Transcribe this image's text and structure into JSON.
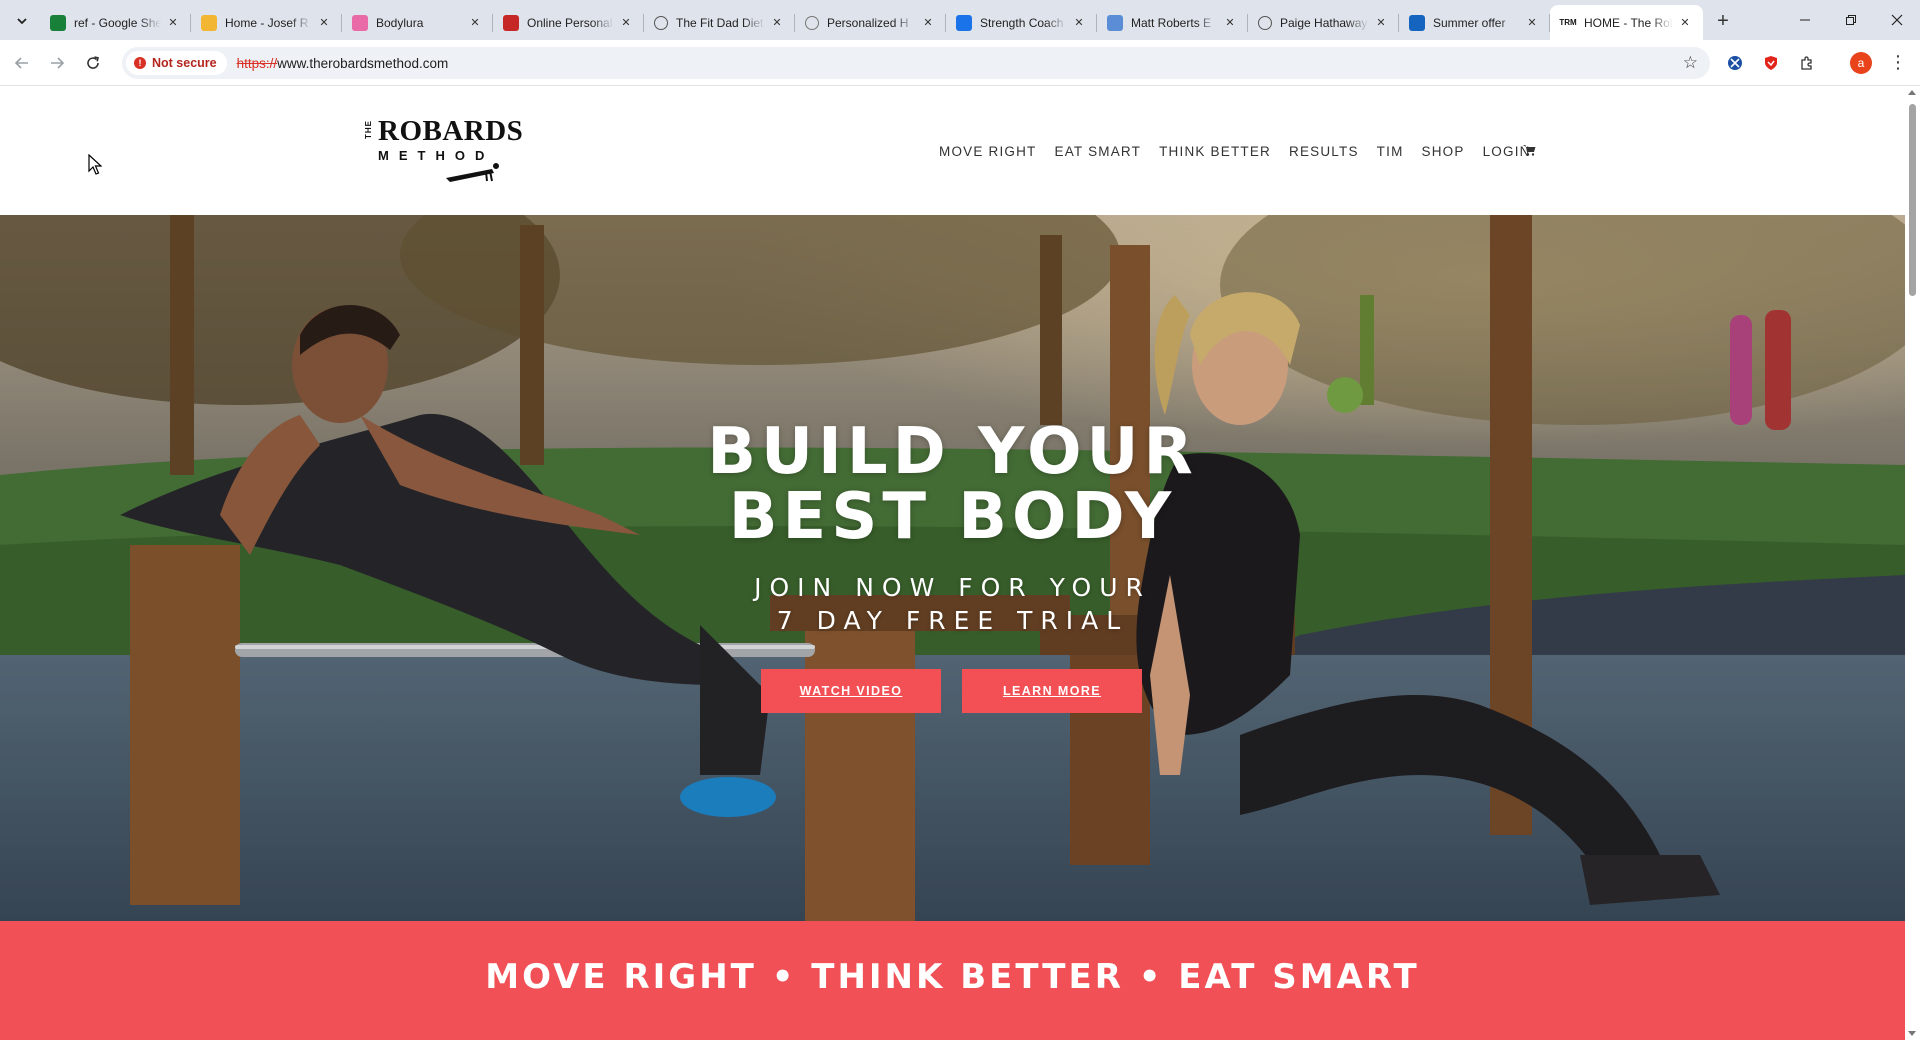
{
  "browser": {
    "tabs": [
      {
        "title": "ref - Google Sheets",
        "favicon": "sheets-icon",
        "color": "#188038"
      },
      {
        "title": "Home - Josef R",
        "favicon": "brand-icon",
        "color": "#f2b632"
      },
      {
        "title": "Bodylura",
        "favicon": "bodylura-icon",
        "color": "#e86aa6"
      },
      {
        "title": "Online Personal",
        "favicon": "brand-icon",
        "color": "#c62828"
      },
      {
        "title": "The Fit Dad Diet",
        "favicon": "globe-icon",
        "color": "#555555"
      },
      {
        "title": "Personalized H",
        "favicon": "globe-icon",
        "color": "#777777"
      },
      {
        "title": "Strength Coach",
        "favicon": "brand-icon",
        "color": "#1a73e8"
      },
      {
        "title": "Matt Roberts E",
        "favicon": "brand-icon",
        "color": "#5b8dd6"
      },
      {
        "title": "Paige Hathaway",
        "favicon": "globe-icon",
        "color": "#555555"
      },
      {
        "title": "Summer offer",
        "favicon": "brand-icon",
        "color": "#1565c0"
      },
      {
        "title": "HOME - The Robards Method",
        "favicon": "trm-icon",
        "color": "#111111",
        "active": true
      }
    ],
    "security_label": "Not secure",
    "url_scheme": "https://",
    "url_rest": "www.therobardsmethod.com",
    "profile_initial": "a"
  },
  "site": {
    "logo": {
      "the": "THE",
      "robards": "ROBARDS",
      "method": "METHOD"
    },
    "nav": [
      "MOVE RIGHT",
      "EAT SMART",
      "THINK BETTER",
      "RESULTS",
      "TIM",
      "SHOP",
      "LOGIN"
    ],
    "hero": {
      "headline_line1": "BUILD YOUR",
      "headline_line2": "BEST BODY",
      "sub_line1": "JOIN NOW FOR YOUR",
      "sub_line2": "7 DAY FREE TRIAL",
      "cta_watch": "WATCH VIDEO",
      "cta_learn": "LEARN MORE"
    },
    "tagline": "MOVE RIGHT • THINK BETTER • EAT SMART",
    "colors": {
      "accent": "#f05056",
      "button": "#f25055"
    }
  }
}
